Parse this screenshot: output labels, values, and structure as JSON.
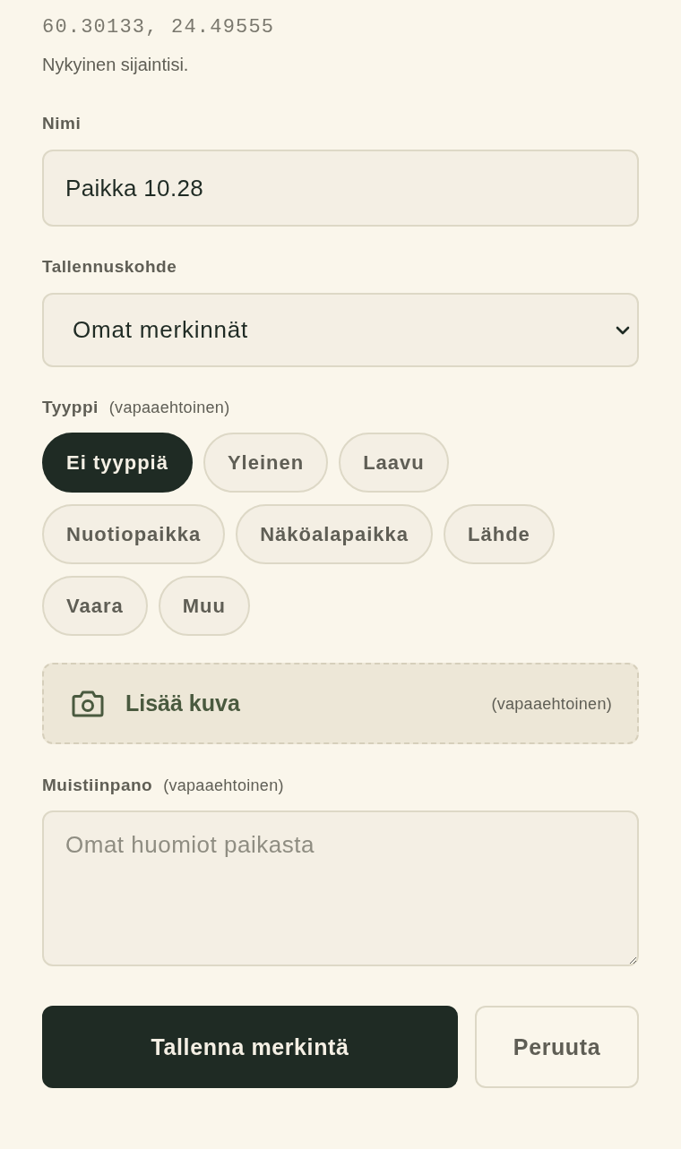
{
  "location": {
    "coordinates": "60.30133, 24.49555",
    "caption": "Nykyinen sijaintisi."
  },
  "name_field": {
    "label": "Nimi",
    "value": "Paikka 10.28"
  },
  "destination_field": {
    "label": "Tallennuskohde",
    "value": "Omat merkinnät"
  },
  "type_field": {
    "label": "Tyyppi",
    "hint": "(vapaaehtoinen)",
    "options": [
      {
        "label": "Ei tyyppiä",
        "selected": true
      },
      {
        "label": "Yleinen",
        "selected": false
      },
      {
        "label": "Laavu",
        "selected": false
      },
      {
        "label": "Nuotiopaikka",
        "selected": false
      },
      {
        "label": "Näköalapaikka",
        "selected": false
      },
      {
        "label": "Lähde",
        "selected": false
      },
      {
        "label": "Vaara",
        "selected": false
      },
      {
        "label": "Muu",
        "selected": false
      }
    ]
  },
  "photo": {
    "label": "Lisää kuva",
    "hint": "(vapaaehtoinen)"
  },
  "note_field": {
    "label": "Muistiinpano",
    "hint": "(vapaaehtoinen)",
    "placeholder": "Omat huomiot paikasta"
  },
  "buttons": [
    {
      "label": "Tallenna merkintä",
      "kind": "primary"
    },
    {
      "label": "Peruuta",
      "kind": "secondary"
    }
  ]
}
